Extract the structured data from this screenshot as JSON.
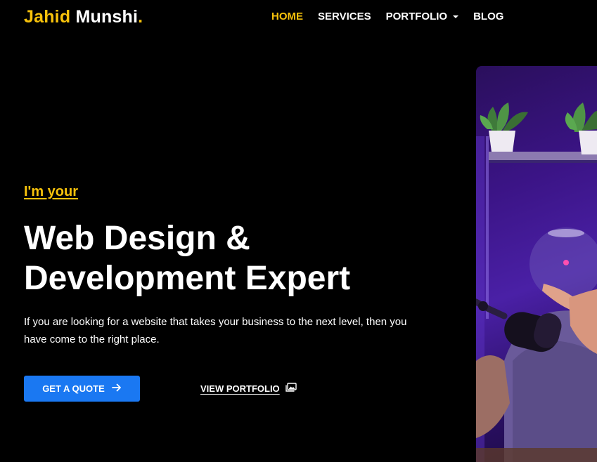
{
  "header": {
    "logo": {
      "first": "Jahid",
      "last": "Munshi",
      "dot": "."
    },
    "nav": {
      "home": "HOME",
      "services": "SERVICES",
      "portfolio": "PORTFOLIO",
      "blog": "BLOG"
    }
  },
  "hero": {
    "eyebrow": "I'm your",
    "headline_line1": "Web Design &",
    "headline_line2": "Development Expert",
    "description": "If you are looking for a website that takes your business to the next level, then you have come to the right place.",
    "cta_label": "GET A QUOTE",
    "cta_icon": "arrow-right-icon",
    "secondary_label": "VIEW PORTFOLIO",
    "secondary_icon": "image-icon"
  },
  "colors": {
    "accent": "#f7c20b",
    "button": "#1a78f2",
    "background": "#000000"
  }
}
